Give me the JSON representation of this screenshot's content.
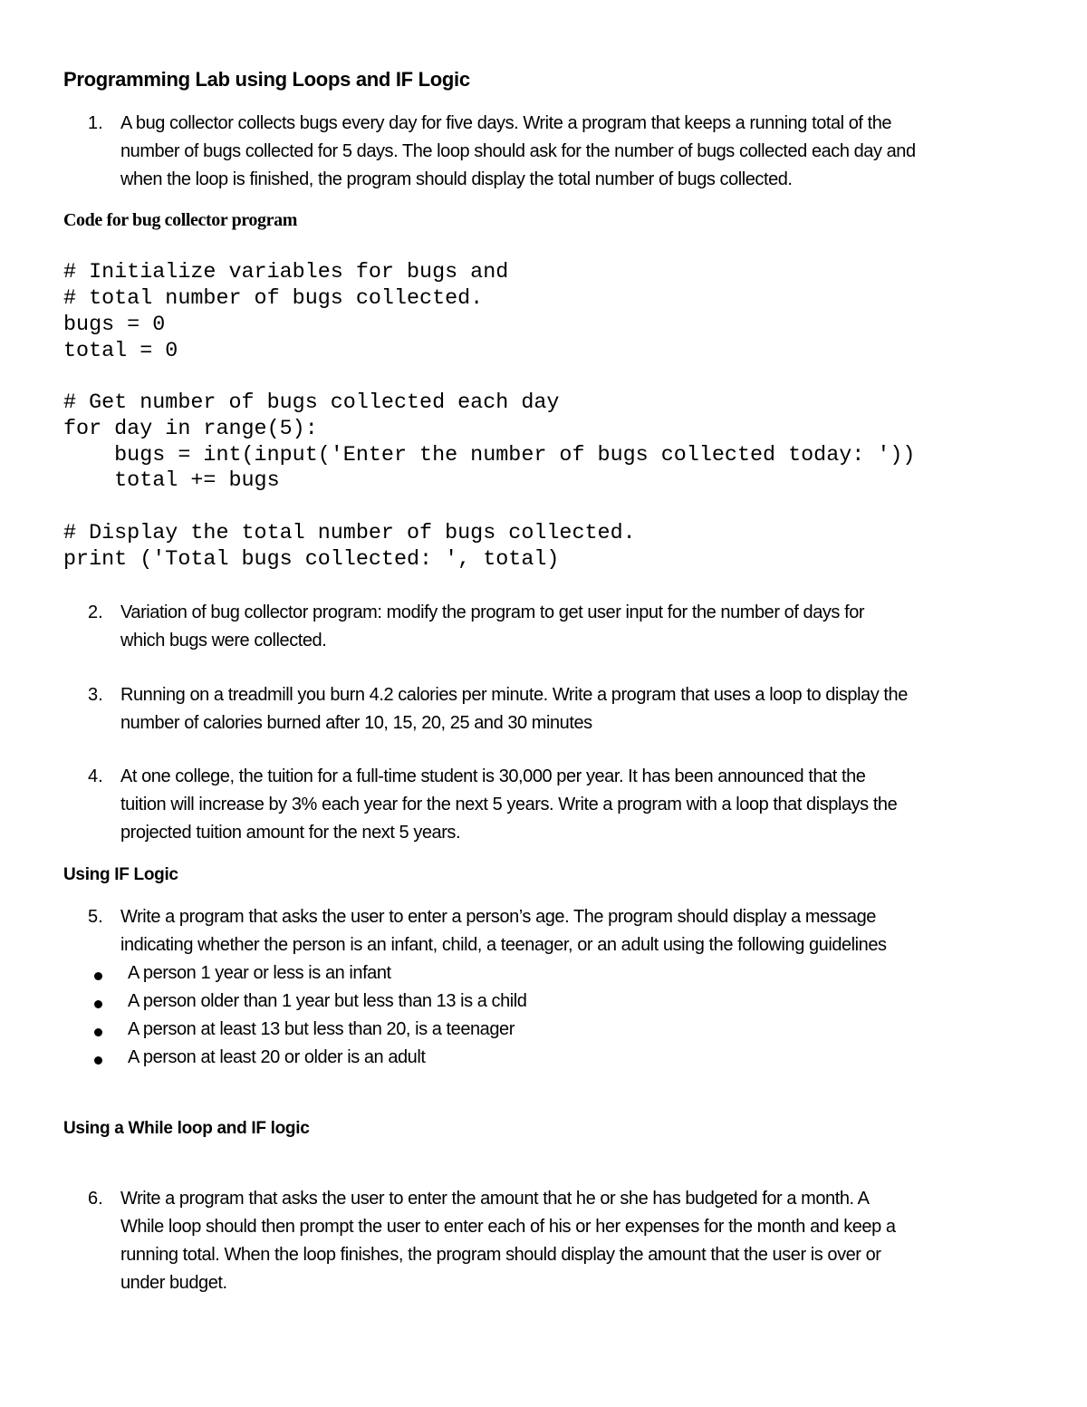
{
  "document": {
    "title": "Programming Lab using Loops and IF Logic",
    "q1": {
      "number": "1.",
      "lines": [
        "A bug collector collects bugs every day for five days. Write a program that keeps a running total of the",
        "number of bugs collected for 5 days. The loop should ask for the number of bugs collected each day and",
        "when the loop is finished, the program should display the total number of bugs collected."
      ]
    },
    "code_heading": "Code for bug collector program",
    "code_lines": [
      "# Initialize variables for bugs and",
      "# total number of bugs collected.",
      "bugs = 0",
      "total = 0",
      "",
      "# Get number of bugs collected each day",
      "for day in range(5):",
      "    bugs = int(input('Enter the number of bugs collected today: '))",
      "    total += bugs",
      "",
      "# Display the total number of bugs collected.",
      "print ('Total bugs collected: ', total)"
    ],
    "q2": {
      "number": "2.",
      "lines": [
        "Variation of bug collector program: modify the program to get user input for the number of days for",
        "which bugs were collected."
      ]
    },
    "q3": {
      "number": "3.",
      "lines": [
        "Running on a treadmill you burn 4.2 calories per minute. Write  a program that uses a loop to display the",
        "number of calories burned after 10, 15, 20, 25 and 30 minutes"
      ]
    },
    "q4": {
      "number": "4.",
      "lines": [
        "At one college, the tuition for a full-time student is 30,000 per year. It has been announced that the",
        "tuition will increase by 3% each year for the next 5 years. Write a program with a loop that displays the",
        "projected tuition amount for the next 5 years."
      ]
    },
    "section_if": "Using IF Logic",
    "q5": {
      "number": "5.",
      "lines": [
        "Write a program that asks the user to enter a person’s age. The program should display a message",
        "indicating whether the person is an infant,  child, a teenager, or an adult using the following guidelines"
      ],
      "bullets": [
        "A person 1 year or less is an infant",
        "A person older than 1 year but less than 13 is a child",
        "A person at least 13 but less than 20, is a teenager",
        "A person at least 20 or older is an adult"
      ]
    },
    "section_while": "Using a While loop and IF logic",
    "q6": {
      "number": "6.",
      "lines": [
        "Write a program that asks the user to enter the amount that he or she has budgeted for a month. A",
        "While loop should then prompt the user to enter each of his or her expenses for the month and keep a",
        "running total. When the loop finishes, the program should display the amount that the user is over or",
        "under budget."
      ]
    }
  }
}
